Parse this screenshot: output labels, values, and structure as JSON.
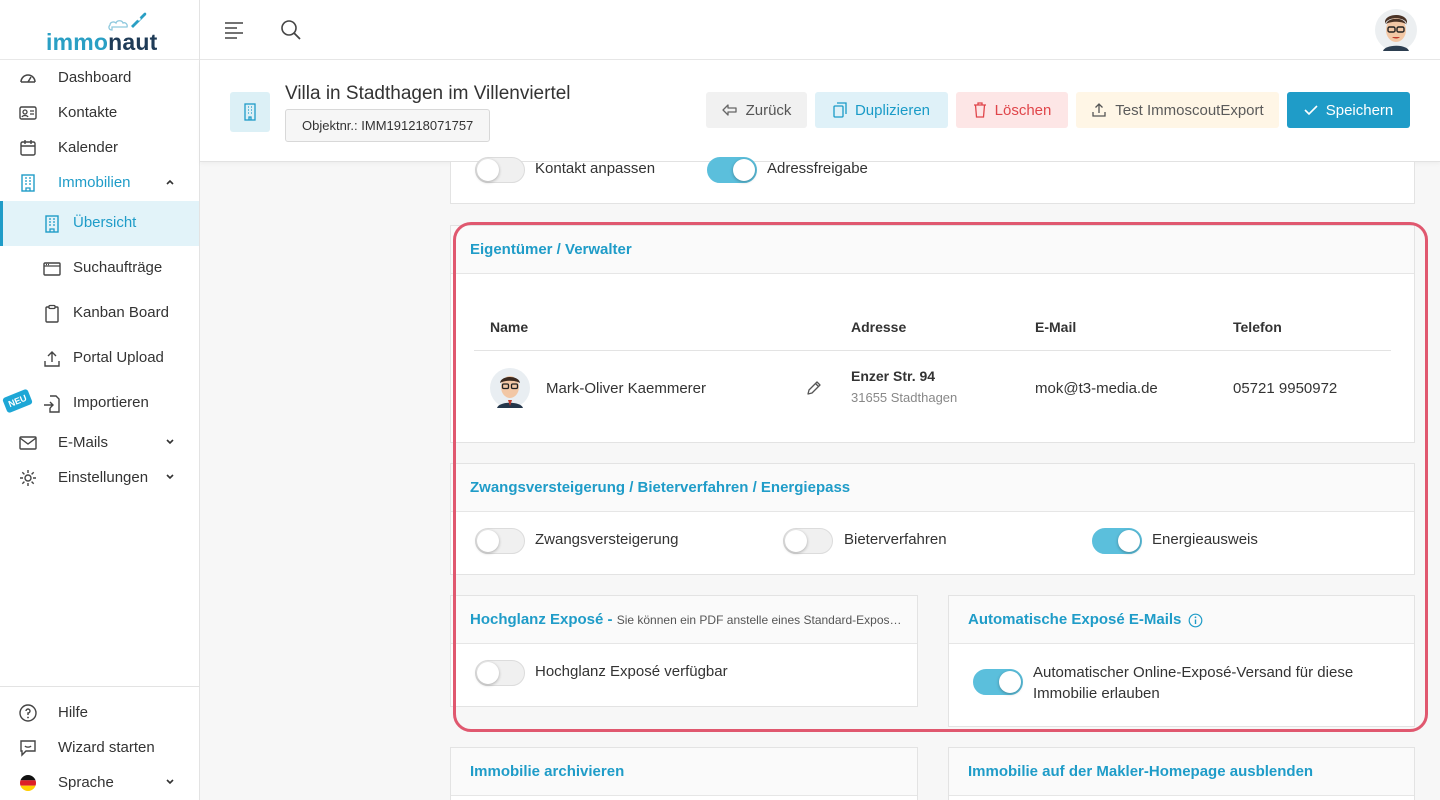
{
  "brand": {
    "logo_part1": "immo",
    "logo_part2": "naut"
  },
  "sidebar": {
    "items": [
      {
        "label": "Dashboard",
        "icon": "dashboard-icon"
      },
      {
        "label": "Kontakte",
        "icon": "contacts-icon"
      },
      {
        "label": "Kalender",
        "icon": "calendar-icon"
      },
      {
        "label": "Immobilien",
        "icon": "building-icon"
      }
    ],
    "subitems": [
      {
        "label": "Übersicht",
        "icon": "building-icon"
      },
      {
        "label": "Suchaufträge",
        "icon": "browser-icon"
      },
      {
        "label": "Kanban Board",
        "icon": "clipboard-icon"
      },
      {
        "label": "Portal Upload",
        "icon": "upload-icon"
      },
      {
        "label": "Importieren",
        "icon": "import-icon"
      }
    ],
    "neu_badge": "NEU",
    "emails": "E-Mails",
    "settings": "Einstellungen",
    "bottom": [
      {
        "label": "Hilfe",
        "icon": "help-icon"
      },
      {
        "label": "Wizard starten",
        "icon": "chat-icon"
      },
      {
        "label": "Sprache",
        "icon": "german-flag-icon"
      }
    ]
  },
  "header": {
    "title": "Villa in Stadthagen im Villenviertel",
    "object_nr": "Objektnr.: IMM191218071757",
    "buttons": {
      "back": "Zurück",
      "duplicate": "Duplizieren",
      "delete": "Löschen",
      "export": "Test ImmoscoutExport",
      "save": "Speichern"
    }
  },
  "top_toggles": [
    {
      "label": "Kontakt anpassen",
      "on": false
    },
    {
      "label": "Adressfreigabe",
      "on": true
    }
  ],
  "owner": {
    "title": "Eigentümer / Verwalter",
    "columns": [
      "Name",
      "Adresse",
      "E-Mail",
      "Telefon"
    ],
    "row": {
      "name": "Mark-Oliver Kaemmerer",
      "street": "Enzer Str. 94",
      "city": "31655 Stadthagen",
      "email": "mok@t3-media.de",
      "phone": "05721 9950972"
    }
  },
  "auction": {
    "title": "Zwangsversteigerung / Bieterverfahren / Energiepass",
    "toggles": [
      {
        "label": "Zwangsversteigerung",
        "on": false
      },
      {
        "label": "Bieterverfahren",
        "on": false
      },
      {
        "label": "Energieausweis",
        "on": true
      }
    ]
  },
  "hochglanz": {
    "title": "Hochglanz Exposé - ",
    "subtitle": "Sie können ein PDF anstelle eines Standard-Expos…",
    "toggle_label": "Hochglanz Exposé verfügbar",
    "on": false
  },
  "auto_expose": {
    "title": "Automatische Exposé E-Mails",
    "toggle_label_line1": "Automatischer Online-Exposé-Versand für diese",
    "toggle_label_line2": "Immobilie erlauben",
    "on": true
  },
  "archive": {
    "title": "Immobilie archivieren"
  },
  "hide_homepage": {
    "title": "Immobilie auf der Makler-Homepage ausblenden"
  },
  "colors": {
    "accent": "#1f9cc8",
    "highlight": "#e0586f",
    "danger": "#e0454a"
  }
}
